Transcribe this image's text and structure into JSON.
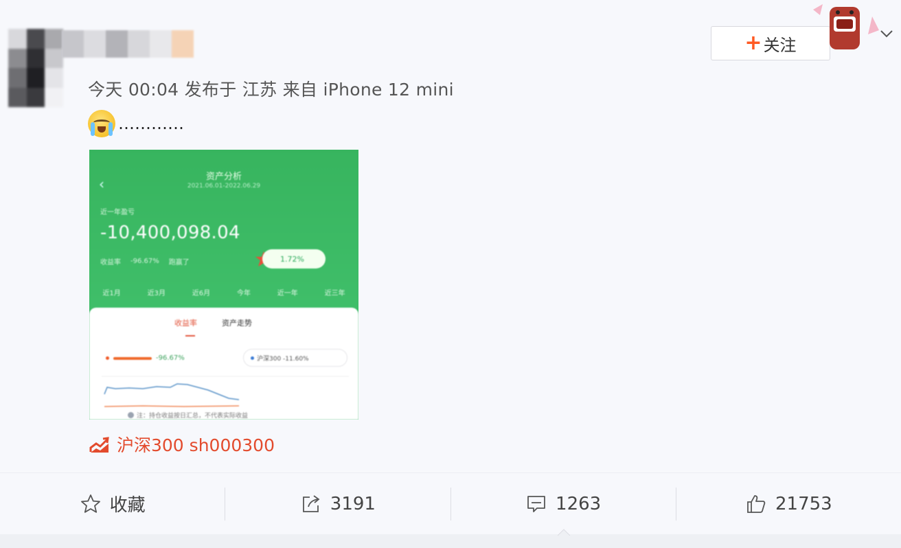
{
  "post": {
    "meta": "今天 00:04 发布于 江苏 来自 iPhone 12 mini",
    "text": "…………",
    "emoji": "crying-face"
  },
  "follow": {
    "plus": "+",
    "label": "关注"
  },
  "screenshot": {
    "title": "资产分析",
    "date_range": "2021.06.01-2022.06.29",
    "period_label": "近一年盈亏",
    "amount": "-10,400,098.04",
    "return_label": "收益率",
    "return_value": "-96.67%",
    "beat_label": "跑赢了",
    "beat_value": "1.72%",
    "tabs": [
      "近1月",
      "近3月",
      "近6月",
      "今年",
      "近一年",
      "近三年"
    ],
    "subtabs": [
      "收益率",
      "资产走势"
    ],
    "legend_mine_value": "-96.67%",
    "legend_index": "沪深300 -11.60%",
    "footer": "注：持仓收益按日汇总，不代表实际收益"
  },
  "stock_tag": {
    "label": "沪深300 sh000300"
  },
  "actions": {
    "favorite": "收藏",
    "repost": "3191",
    "comment": "1263",
    "like": "21753"
  },
  "colors": {
    "accent": "#ff5a23",
    "stock": "#e34b2d",
    "green": "#3cb966"
  }
}
